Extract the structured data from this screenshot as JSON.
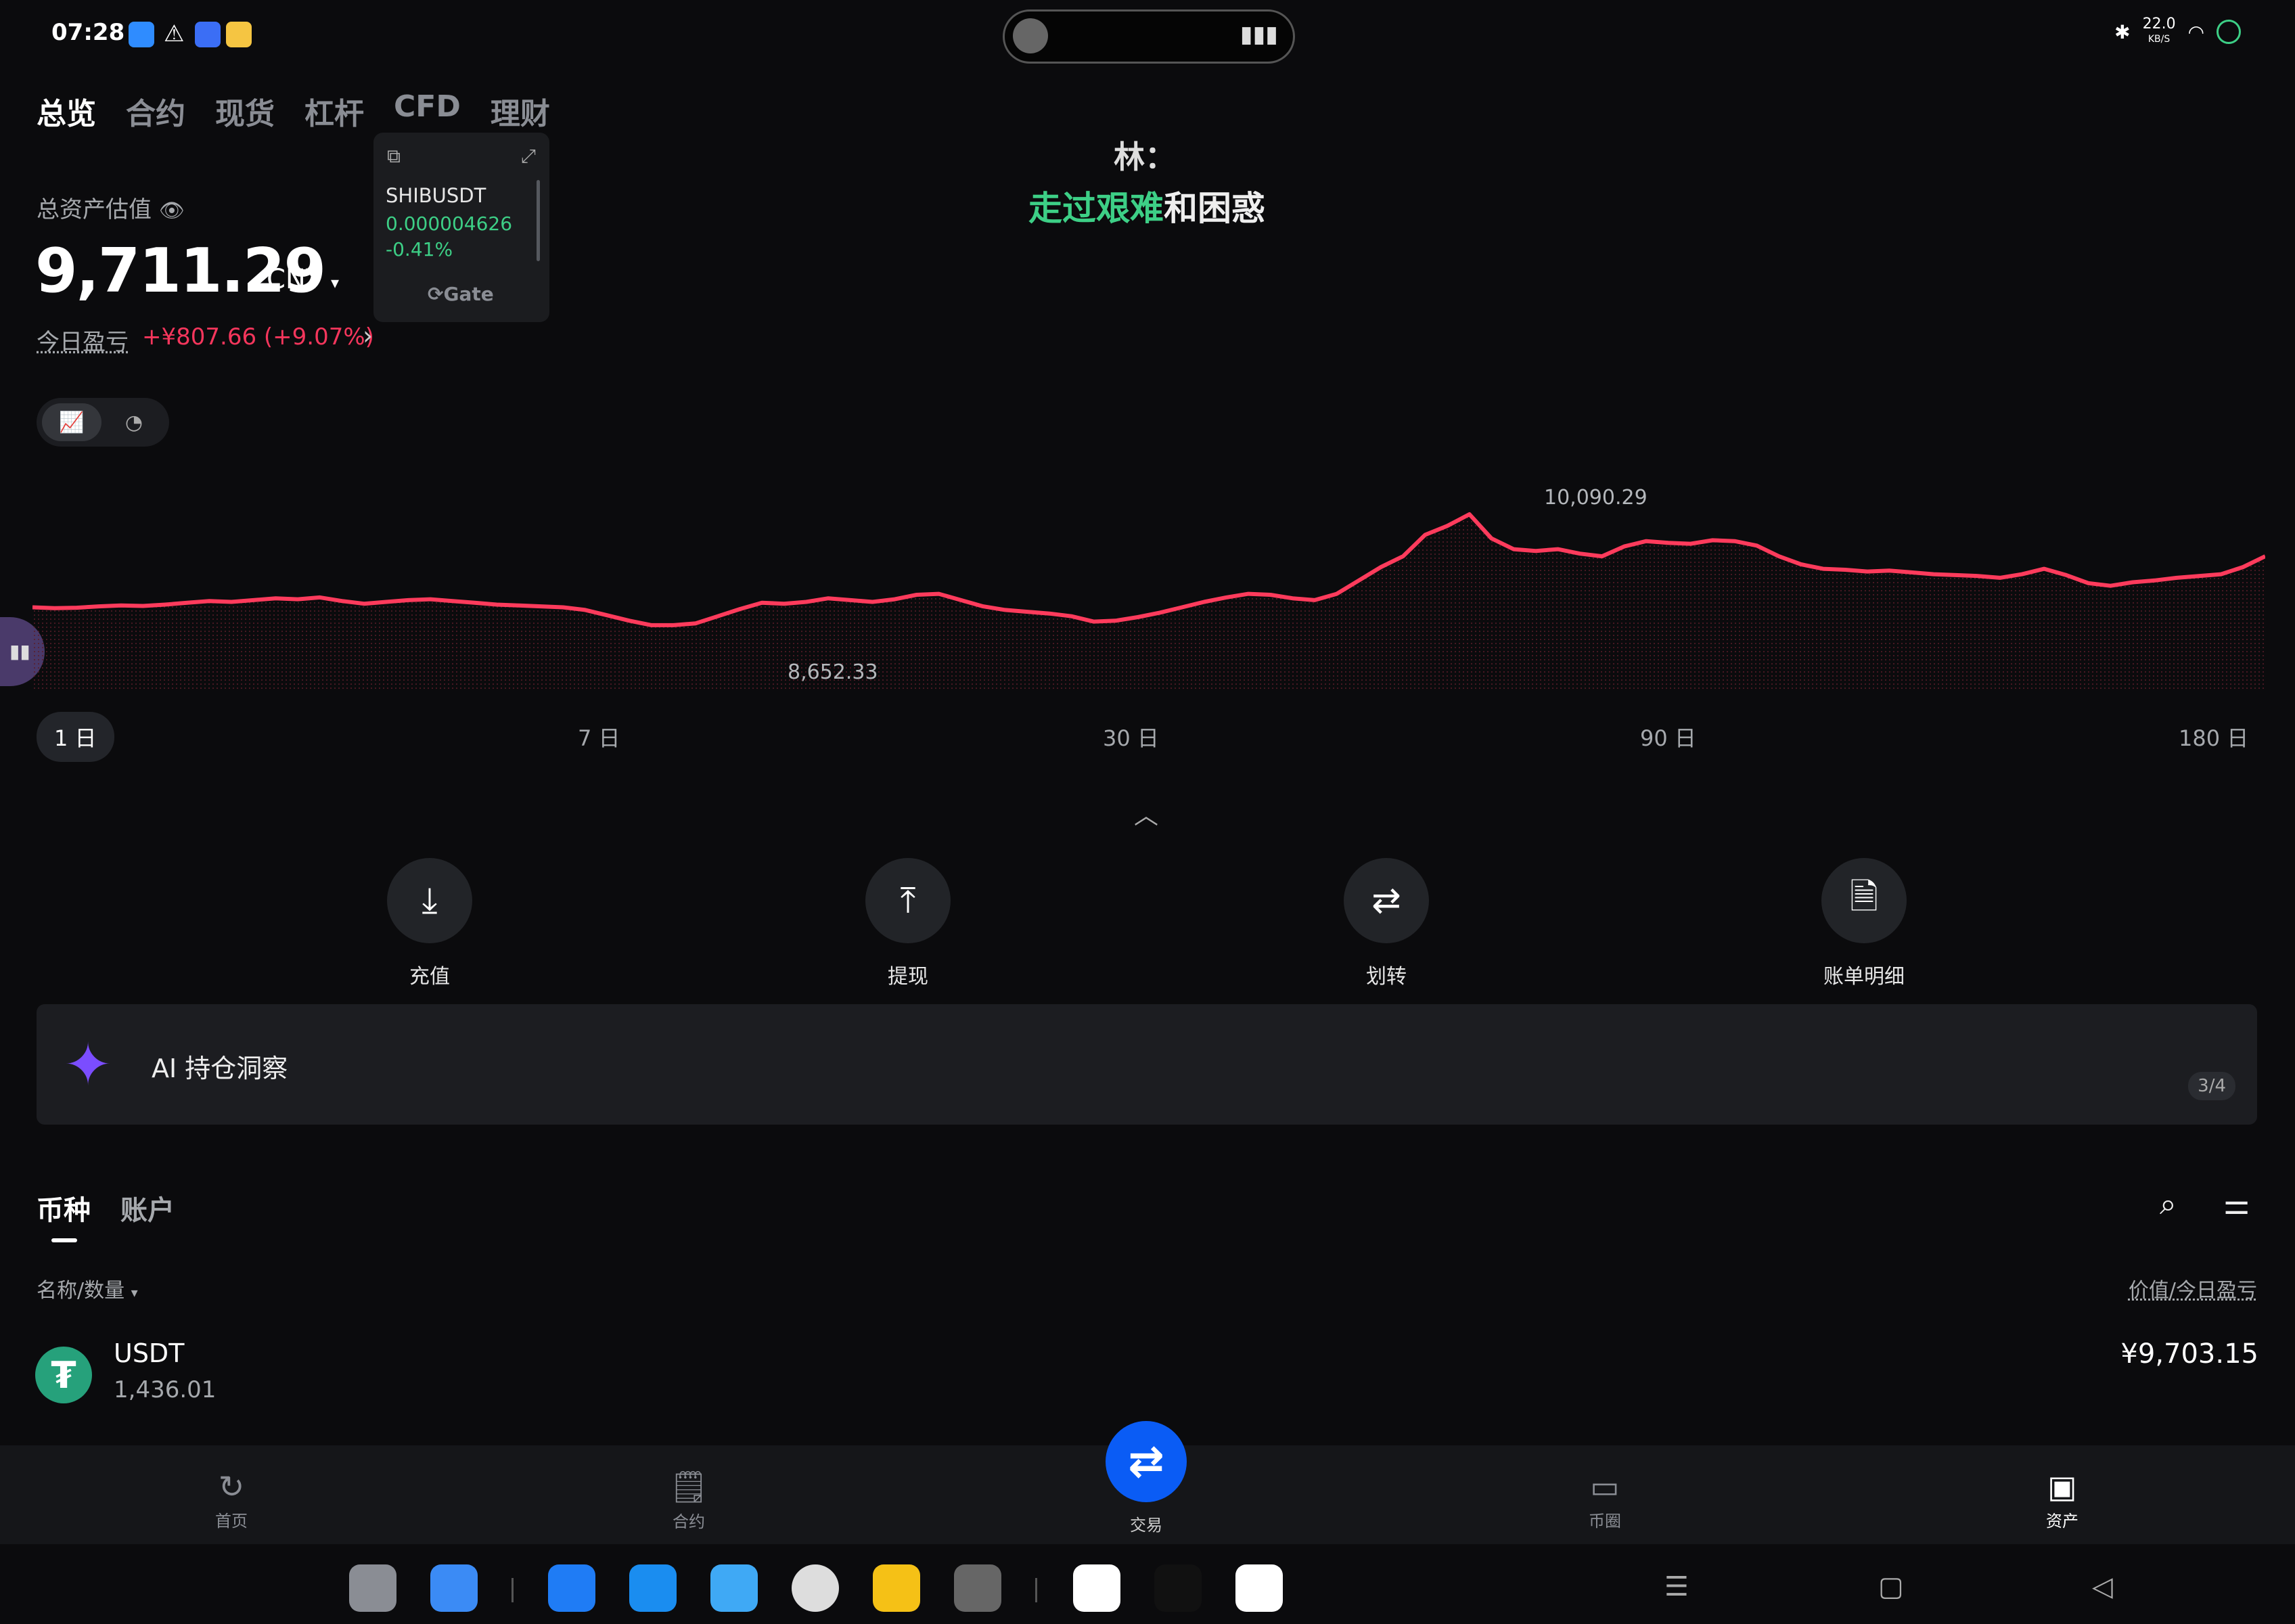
{
  "status": {
    "time": "07:28",
    "speed": "22.0",
    "speed_unit": "KB/S"
  },
  "top_tabs": [
    "总览",
    "合约",
    "现货",
    "杠杆",
    "CFD",
    "理财"
  ],
  "lyric": {
    "line1": "林：",
    "line2_green": "走过艰难",
    "line2_white": "和困惑"
  },
  "widget": {
    "symbol": "SHIBUSDT",
    "price": "0.000004626",
    "change": "-0.41%",
    "brand": "Gate"
  },
  "total": {
    "label": "总资产估值",
    "value": "9,711.29",
    "currency": "CNY",
    "pnl_label": "今日盈亏",
    "pnl_value": "+¥807.66 (+9.07%)"
  },
  "chart_data": {
    "type": "line",
    "max_label": "10,090.29",
    "min_label": "8,652.33",
    "values": [
      9050,
      9040,
      9045,
      9060,
      9070,
      9065,
      9080,
      9100,
      9120,
      9110,
      9130,
      9150,
      9140,
      9160,
      9120,
      9090,
      9110,
      9130,
      9140,
      9120,
      9100,
      9080,
      9070,
      9060,
      9050,
      9020,
      8960,
      8900,
      8850,
      8850,
      8870,
      8950,
      9030,
      9100,
      9090,
      9110,
      9150,
      9130,
      9110,
      9140,
      9190,
      9200,
      9130,
      9060,
      9020,
      9000,
      8980,
      8950,
      8890,
      8900,
      8940,
      8990,
      9050,
      9110,
      9160,
      9200,
      9190,
      9150,
      9130,
      9200,
      9350,
      9500,
      9620,
      9860,
      9960,
      10090,
      9820,
      9700,
      9680,
      9700,
      9650,
      9620,
      9730,
      9790,
      9770,
      9760,
      9800,
      9790,
      9740,
      9620,
      9530,
      9480,
      9470,
      9450,
      9460,
      9440,
      9420,
      9410,
      9400,
      9380,
      9420,
      9480,
      9410,
      9320,
      9290,
      9330,
      9350,
      9380,
      9400,
      9420,
      9500,
      9620
    ],
    "ranges": [
      "1 日",
      "7 日",
      "30 日",
      "90 日",
      "180 日"
    ],
    "active_range": "1 日",
    "line_color": "#ff3b5c"
  },
  "actions": [
    "充值",
    "提现",
    "划转",
    "账单明细"
  ],
  "ai_card": {
    "title": "AI 持仓洞察",
    "page": "3/4"
  },
  "list_tabs": [
    "币种",
    "账户"
  ],
  "list_header": {
    "left": "名称/数量",
    "right": "价值/今日盈亏"
  },
  "coins": [
    {
      "name": "USDT",
      "qty": "1,436.01",
      "value": "¥9,703.15"
    }
  ],
  "bottom_nav": [
    "首页",
    "合约",
    "交易",
    "币圈",
    "资产"
  ],
  "colors": {
    "accent": "#0a5cf5",
    "positive": "#3dcf86",
    "negative": "#f5365c",
    "usdt": "#26a17b"
  }
}
